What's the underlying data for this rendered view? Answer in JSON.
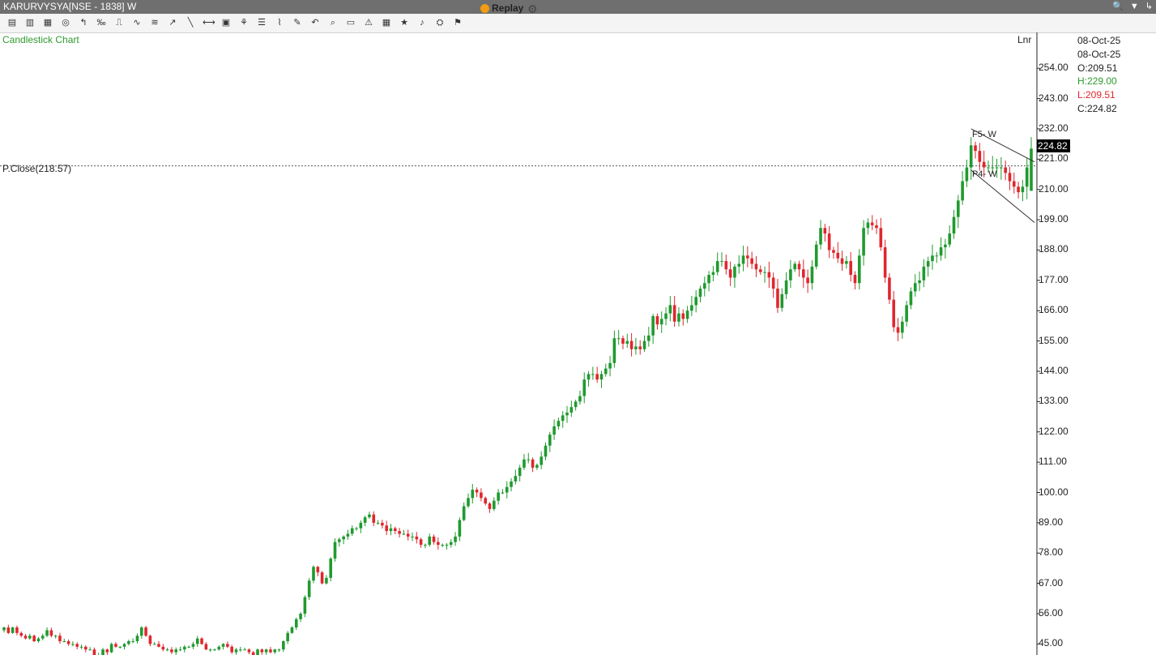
{
  "window": {
    "title": "KARURVYSYA[NSE - 1838] W"
  },
  "toolbar": {
    "icons": [
      "bar-chart-icon",
      "candle-chart-icon",
      "line-chart-icon",
      "crosshair-icon",
      "pointer-icon",
      "interval-icon",
      "compare-icon",
      "study-icon",
      "draw-icon",
      "cursor-icon",
      "line-tool-icon",
      "trendline-icon",
      "horizontal-line-icon",
      "cube-icon",
      "fib-icon",
      "parallel-icon",
      "ruler-icon",
      "undo-icon",
      "zoom-icon",
      "template-icon",
      "alerts-icon",
      "table-icon",
      "star-icon",
      "bell-icon",
      "settings-icon",
      "snapshot-icon"
    ],
    "replay_label": "Replay"
  },
  "chart": {
    "title": "Candlestick Chart",
    "scale_type": "Lnr",
    "prev_close_label": "P.Close(218.57)",
    "prev_close": 218.57,
    "last_price_label": "224.82",
    "annotations": {
      "f5": "F5- W",
      "f4": "P4- W"
    }
  },
  "ohlc_panel": {
    "date1": "08-Oct-25",
    "date2": "08-Oct-25",
    "open": "O:209.51",
    "high": "H:229.00",
    "low": "L:209.51",
    "close": "C:224.82"
  },
  "colors": {
    "up": "#1f9a2e",
    "down": "#e0262e",
    "title_green": "#2e9b2e"
  },
  "chart_data": {
    "type": "candlestick",
    "title": "Candlestick Chart",
    "ylim": [
      41,
      262
    ],
    "y_ticks": [
      "254.00",
      "243.00",
      "232.00",
      "221.00",
      "210.00",
      "199.00",
      "188.00",
      "177.00",
      "166.00",
      "155.00",
      "144.00",
      "133.00",
      "122.00",
      "111.00",
      "100.00",
      "89.00",
      "78.00",
      "67.00",
      "56.00",
      "45.00"
    ],
    "series": [
      {
        "closes": [
          51,
          49,
          51,
          49,
          48,
          47,
          48,
          46,
          47,
          48,
          50,
          48,
          48,
          46,
          46,
          45,
          45,
          44,
          44,
          43,
          43,
          41,
          41,
          43,
          42,
          45,
          44,
          44,
          45,
          46,
          46,
          48,
          51,
          48,
          45,
          45,
          44,
          43,
          43,
          42,
          43,
          43,
          44,
          44,
          45,
          47,
          45,
          43,
          43,
          43,
          44,
          45,
          44,
          42,
          43,
          43,
          43,
          42,
          41,
          43,
          42,
          43,
          42,
          43,
          43,
          46,
          49,
          51,
          54,
          56,
          62,
          68,
          73,
          71,
          67,
          69,
          76,
          82,
          83,
          84,
          85,
          87,
          87,
          89,
          91,
          92,
          89,
          89,
          88,
          86,
          87,
          86,
          85,
          85,
          84,
          84,
          83,
          81,
          81,
          84,
          82,
          81,
          81,
          81,
          82,
          84,
          90,
          95,
          98,
          101,
          100,
          98,
          96,
          94,
          97,
          100,
          100,
          102,
          104,
          106,
          109,
          112,
          112,
          109,
          110,
          113,
          117,
          121,
          124,
          126,
          128,
          129,
          131,
          133,
          135,
          141,
          143,
          143,
          141,
          143,
          145,
          147,
          156,
          156,
          154,
          155,
          152,
          153,
          152,
          155,
          157,
          164,
          161,
          163,
          165,
          168,
          162,
          165,
          163,
          166,
          168,
          171,
          174,
          176,
          179,
          180,
          184,
          184,
          181,
          178,
          182,
          183,
          186,
          185,
          183,
          181,
          180,
          180,
          178,
          174,
          167,
          172,
          177,
          181,
          183,
          181,
          178,
          176,
          182,
          190,
          196,
          194,
          188,
          187,
          185,
          183,
          184,
          179,
          176,
          186,
          196,
          198,
          197,
          196,
          189,
          178,
          170,
          160,
          158,
          162,
          168,
          173,
          176,
          177,
          182,
          184,
          186,
          186,
          189,
          190,
          194,
          200,
          206,
          213,
          218,
          226,
          224,
          220,
          218,
          218,
          218,
          218,
          218,
          216,
          213,
          211,
          209,
          211,
          218,
          224.82
        ]
      }
    ],
    "last_candle": {
      "open": 209.51,
      "high": 229.0,
      "low": 209.51,
      "close": 224.82
    }
  }
}
